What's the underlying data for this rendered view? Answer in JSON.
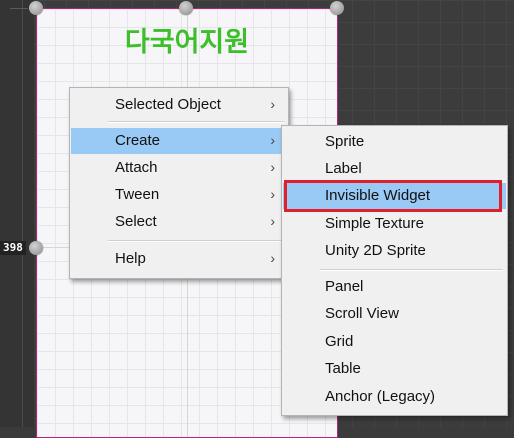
{
  "canvas": {
    "title": "다국어지원",
    "coord_label": "398"
  },
  "context_menu": {
    "items": [
      {
        "label": "Selected Object",
        "arrow": "›"
      },
      {
        "label": "Create",
        "arrow": "›"
      },
      {
        "label": "Attach",
        "arrow": "›"
      },
      {
        "label": "Tween",
        "arrow": "›"
      },
      {
        "label": "Select",
        "arrow": "›"
      },
      {
        "label": "Help",
        "arrow": "›"
      }
    ],
    "highlighted": "Create"
  },
  "create_submenu": {
    "items": [
      {
        "label": "Sprite"
      },
      {
        "label": "Label"
      },
      {
        "label": "Invisible Widget"
      },
      {
        "label": "Simple Texture"
      },
      {
        "label": "Unity 2D Sprite"
      },
      {
        "label": "Panel"
      },
      {
        "label": "Scroll View"
      },
      {
        "label": "Grid"
      },
      {
        "label": "Table"
      },
      {
        "label": "Anchor (Legacy)"
      }
    ],
    "highlighted": "Invisible Widget"
  },
  "annotation": {
    "color": "#e0202c",
    "target": "Invisible Widget"
  },
  "colors": {
    "menu_highlight": "#99c9f5",
    "title_green": "#3cbf2a",
    "canvas_border": "#b0247a"
  }
}
